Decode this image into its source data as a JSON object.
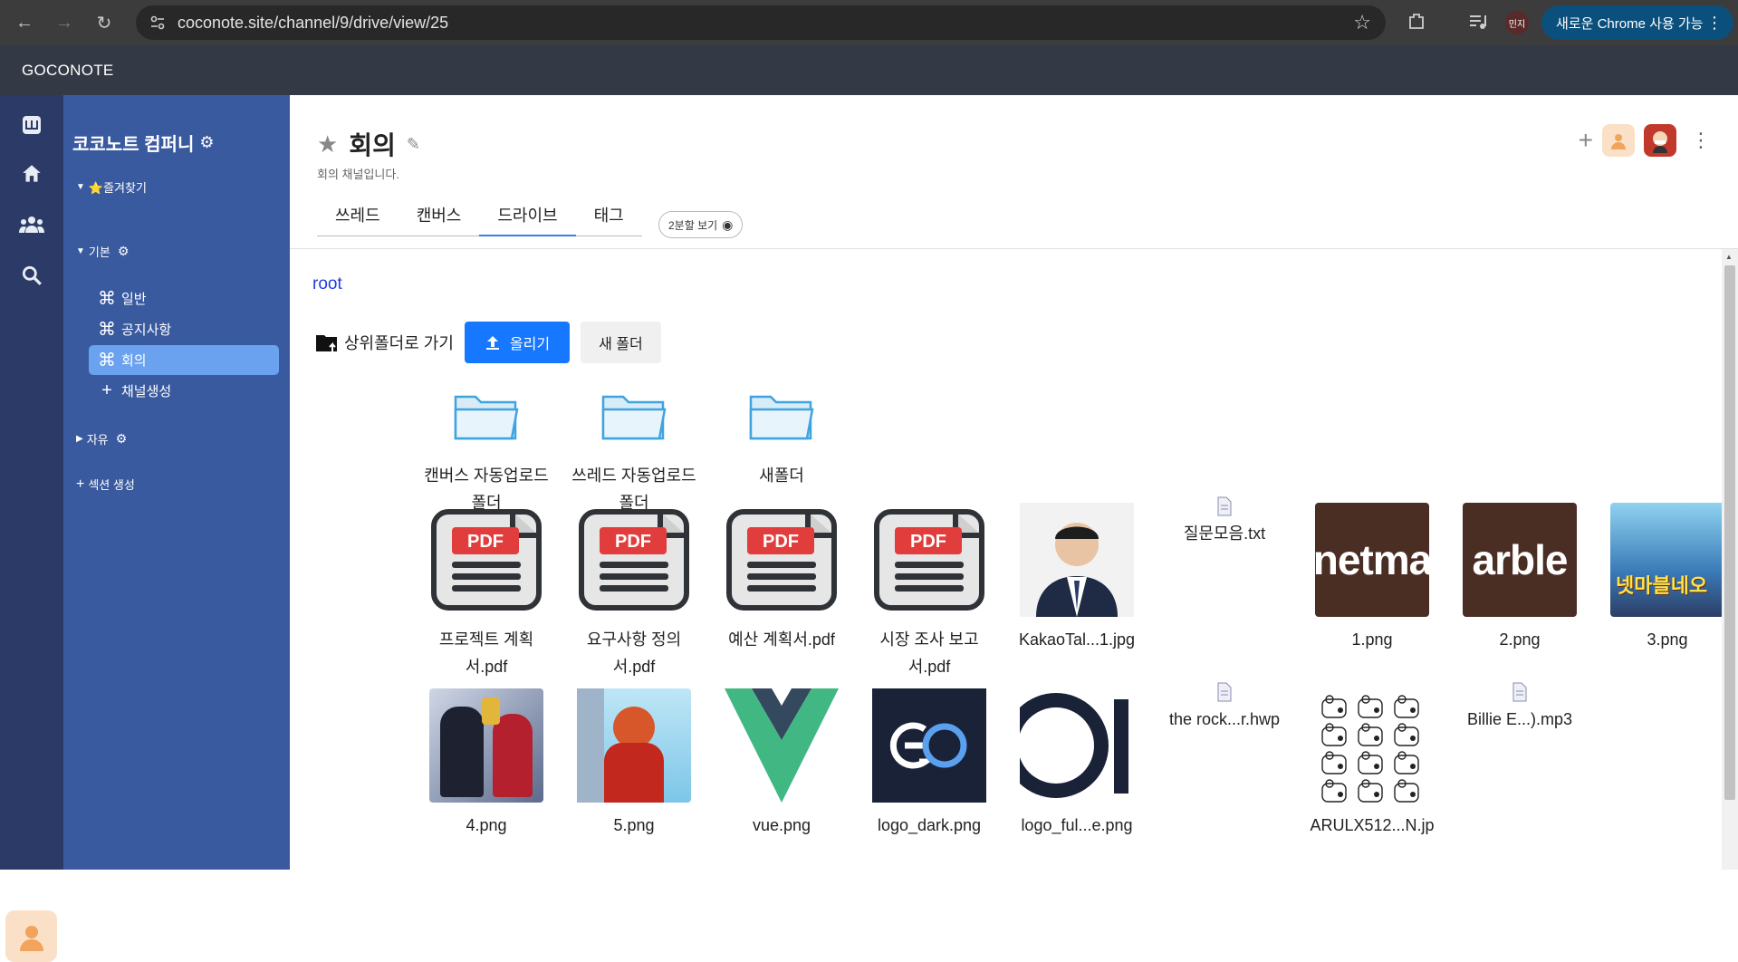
{
  "browser": {
    "url": "coconote.site/channel/9/drive/view/25",
    "profile_label": "민지",
    "chrome_update_label": "새로운 Chrome 사용 가능"
  },
  "app": {
    "logo": "GOCONOTE"
  },
  "sidebar": {
    "workspace_title": "코코노트 컴퍼니",
    "favorites_label": "⭐즐겨찾기",
    "basic_section_label": "기본",
    "channels": [
      {
        "label": "일반"
      },
      {
        "label": "공지사항"
      },
      {
        "label": "회의"
      }
    ],
    "create_channel_label": "채널생성",
    "free_section_label": "자유",
    "create_section_label": "섹션 생성"
  },
  "channel": {
    "title": "회의",
    "description": "회의 채널입니다.",
    "tabs": [
      "쓰레드",
      "캔버스",
      "드라이브",
      "태그"
    ],
    "active_tab": "드라이브",
    "split_view_label": "2분할 보기"
  },
  "drive": {
    "breadcrumb": "root",
    "go_up_label": "상위폴더로 가기",
    "upload_label": "올리기",
    "new_folder_label": "새 폴더",
    "folders": [
      {
        "name_line1": "캔버스 자동업로드",
        "name_line2": "폴더"
      },
      {
        "name_line1": "쓰레드 자동업로드",
        "name_line2": "폴더"
      },
      {
        "name_line1": "새폴더",
        "name_line2": ""
      }
    ],
    "files_row1": [
      {
        "name_line1": "프로젝트 계획",
        "name_line2": "서.pdf",
        "kind": "pdf"
      },
      {
        "name_line1": "요구사항 정의",
        "name_line2": "서.pdf",
        "kind": "pdf"
      },
      {
        "name_line1": "예산 계획서.pdf",
        "name_line2": "",
        "kind": "pdf"
      },
      {
        "name_line1": "시장 조사 보고",
        "name_line2": "서.pdf",
        "kind": "pdf"
      },
      {
        "name_line1": "KakaoTal...1.jpg",
        "name_line2": "",
        "kind": "photo"
      },
      {
        "name_line1": "질문모음.txt",
        "name_line2": "",
        "kind": "doc"
      },
      {
        "name_line1": "1.png",
        "name_line2": "",
        "kind": "netmarble-1",
        "thumb_text": "netma"
      },
      {
        "name_line1": "2.png",
        "name_line2": "",
        "kind": "netmarble-2",
        "thumb_text": "arble"
      },
      {
        "name_line1": "3.png",
        "name_line2": "",
        "kind": "game-art",
        "thumb_text": "넷마블네오"
      }
    ],
    "files_row2": [
      {
        "name_line1": "4.png",
        "kind": "anime"
      },
      {
        "name_line1": "5.png",
        "kind": "anime2"
      },
      {
        "name_line1": "vue.png",
        "kind": "vue"
      },
      {
        "name_line1": "logo_dark.png",
        "kind": "logo-dark"
      },
      {
        "name_line1": "logo_ful...e.png",
        "kind": "logo-full"
      },
      {
        "name_line1": "the rock...r.hwp",
        "kind": "doc"
      },
      {
        "name_line1": "ARULX512...N.jp",
        "kind": "sketch"
      },
      {
        "name_line1": "Billie E...).mp3",
        "kind": "doc"
      }
    ]
  },
  "colors": {
    "rail": "#2b3a67",
    "sidebar": "#3a5a9f",
    "active_channel": "#6aa2f0",
    "upload_button": "#1677ff",
    "tab_underline": "#3d7ce0",
    "breadcrumb": "#1f3ee0"
  }
}
